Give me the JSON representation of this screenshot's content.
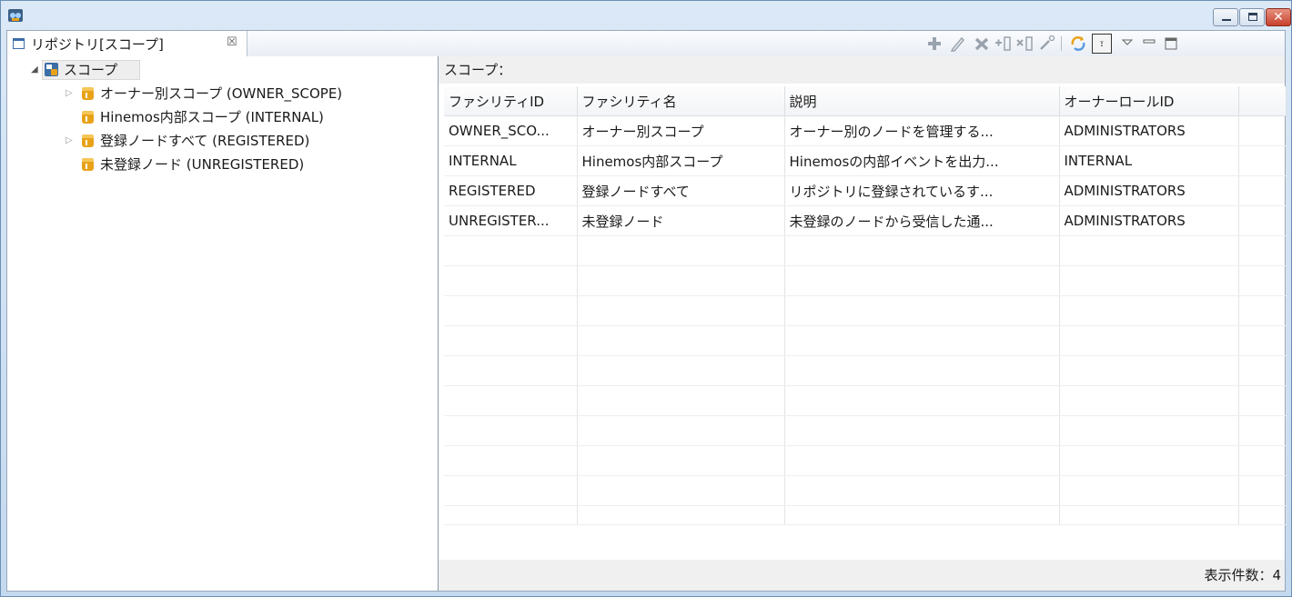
{
  "window": {
    "controls": [
      "minimize",
      "maximize",
      "close"
    ],
    "close_glyph": "✕"
  },
  "tab": {
    "label": "リポジトリ[スコープ]",
    "close_glyph": "☒"
  },
  "toolbar": {
    "icons": [
      "add-icon",
      "edit-icon",
      "delete-icon",
      "assign-node-icon",
      "release-node-icon",
      "wand-icon",
      "refresh-icon",
      "tree-view-icon",
      "view-menu-icon",
      "minimize-view-icon",
      "maximize-view-icon"
    ],
    "tree_view_glyph": "፣"
  },
  "tree": {
    "root": {
      "label": "スコープ",
      "expanded": true
    },
    "items": [
      {
        "label": "オーナー別スコープ (OWNER_SCOPE)",
        "has_children": true
      },
      {
        "label": "Hinemos内部スコープ (INTERNAL)",
        "has_children": false
      },
      {
        "label": "登録ノードすべて (REGISTERED)",
        "has_children": true
      },
      {
        "label": "未登録ノード (UNREGISTERED)",
        "has_children": false
      }
    ]
  },
  "right": {
    "scope_label": "スコープ：",
    "columns": [
      "ファシリティID",
      "ファシリティ名",
      "説明",
      "オーナーロールID"
    ],
    "rows": [
      [
        "OWNER_SCO...",
        "オーナー別スコープ",
        "オーナー別のノードを管理する...",
        "ADMINISTRATORS"
      ],
      [
        "INTERNAL",
        "Hinemos内部スコープ",
        "Hinemosの内部イベントを出力...",
        "INTERNAL"
      ],
      [
        "REGISTERED",
        "登録ノードすべて",
        "リポジトリに登録されているす...",
        "ADMINISTRATORS"
      ],
      [
        "UNREGISTER...",
        "未登録ノード",
        "未登録のノードから受信した通...",
        "ADMINISTRATORS"
      ]
    ],
    "count_label": "表示件数：4"
  },
  "colors": {
    "accent": "#3b6da6",
    "folder": "#e8a21a",
    "close_button": "#c7402c"
  }
}
